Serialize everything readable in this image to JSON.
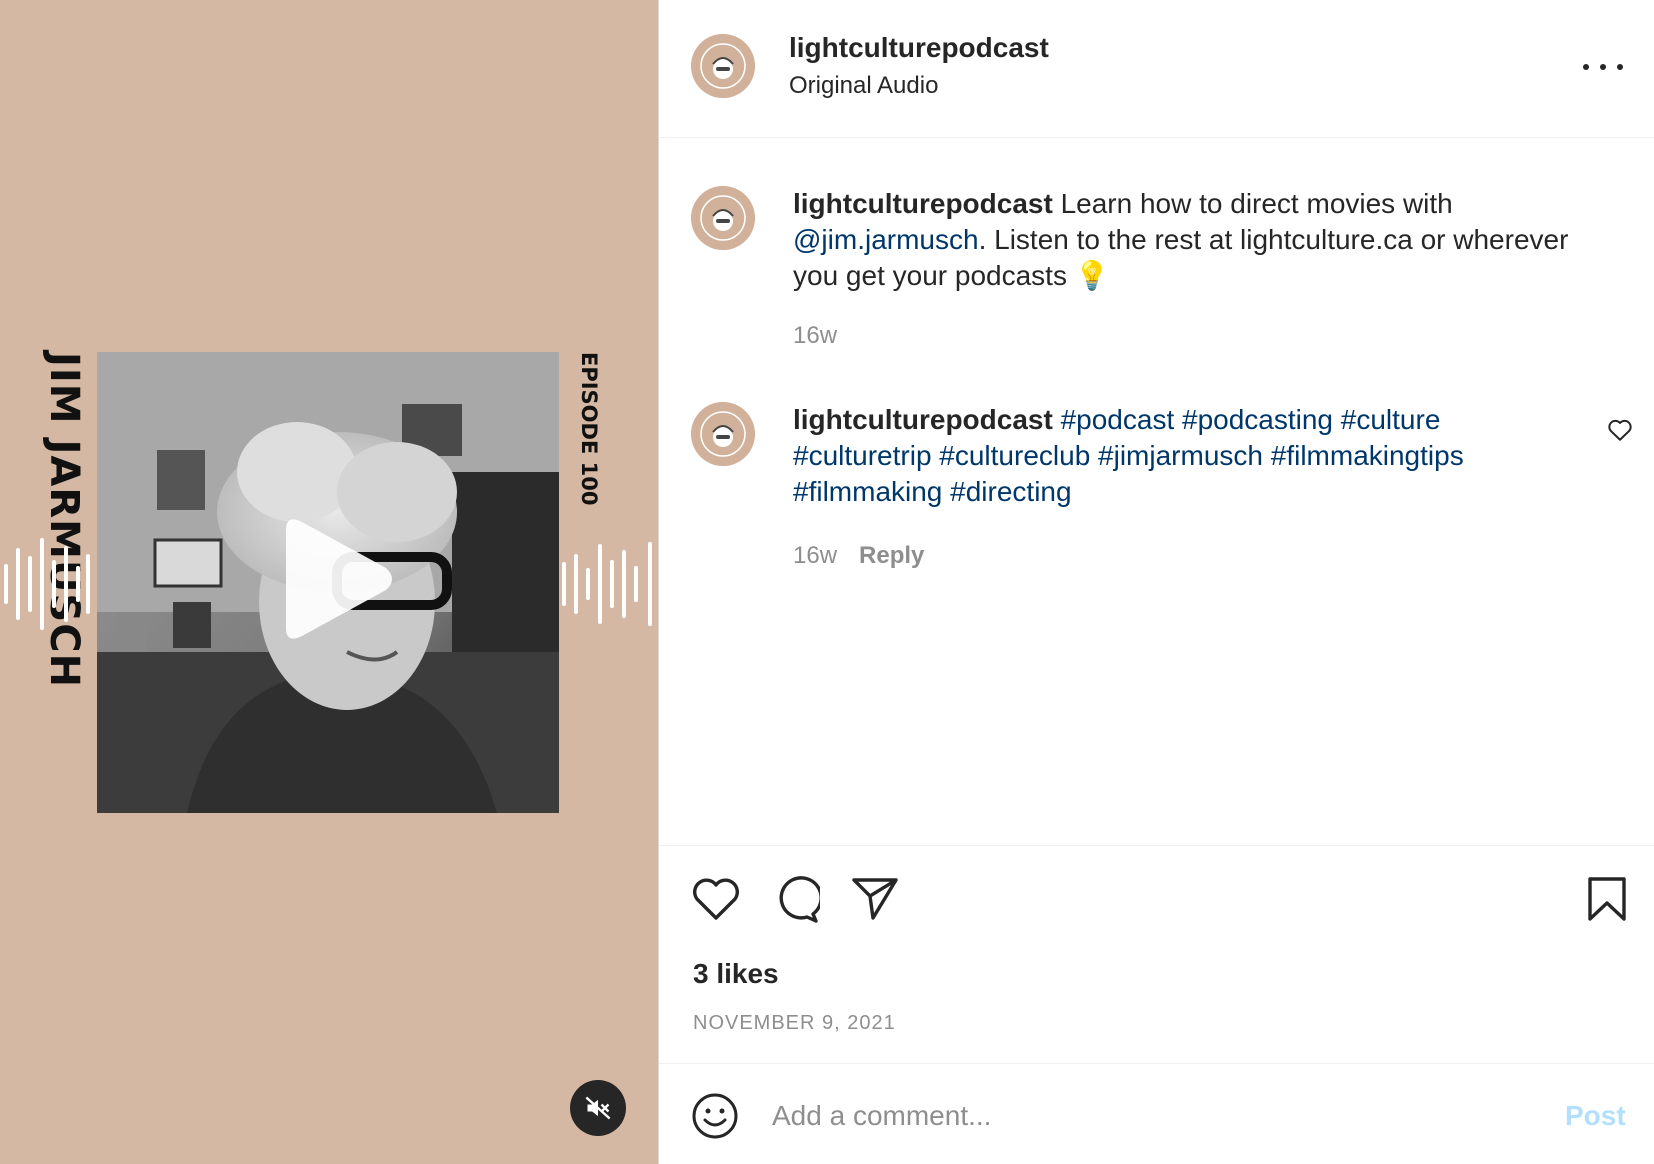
{
  "media": {
    "side_title": "JIM JARMUSCH",
    "episode_label": "EPISODE 100",
    "bg_color": "#d5b8a3",
    "play_icon": "play-icon",
    "mute_icon": "speaker-muted-icon"
  },
  "header": {
    "username": "lightculturepodcast",
    "subtitle": "Original Audio",
    "more_icon": "more-options-icon",
    "avatar_text": "Light Culture"
  },
  "caption": {
    "username": "lightculturepodcast",
    "text_before": "Learn how to direct movies with ",
    "mention": "@jim.jarmusch",
    "text_after": ". Listen to the rest at lightculture.ca or wherever you get your podcasts ",
    "emoji": "💡",
    "time": "16w"
  },
  "comment": {
    "username": "lightculturepodcast",
    "hashtags": "#podcast #podcasting #culture #culturetrip #cultureclub #jimjarmusch #filmmakingtips #filmmaking #directing",
    "time": "16w",
    "reply_label": "Reply"
  },
  "actions": {
    "likes": "3 likes",
    "date": "NOVEMBER 9, 2021"
  },
  "comment_box": {
    "placeholder": "Add a comment...",
    "post_label": "Post"
  },
  "colors": {
    "link": "#00376b",
    "post_disabled": "#b2dffc",
    "muted_text": "#8e8e8e"
  }
}
